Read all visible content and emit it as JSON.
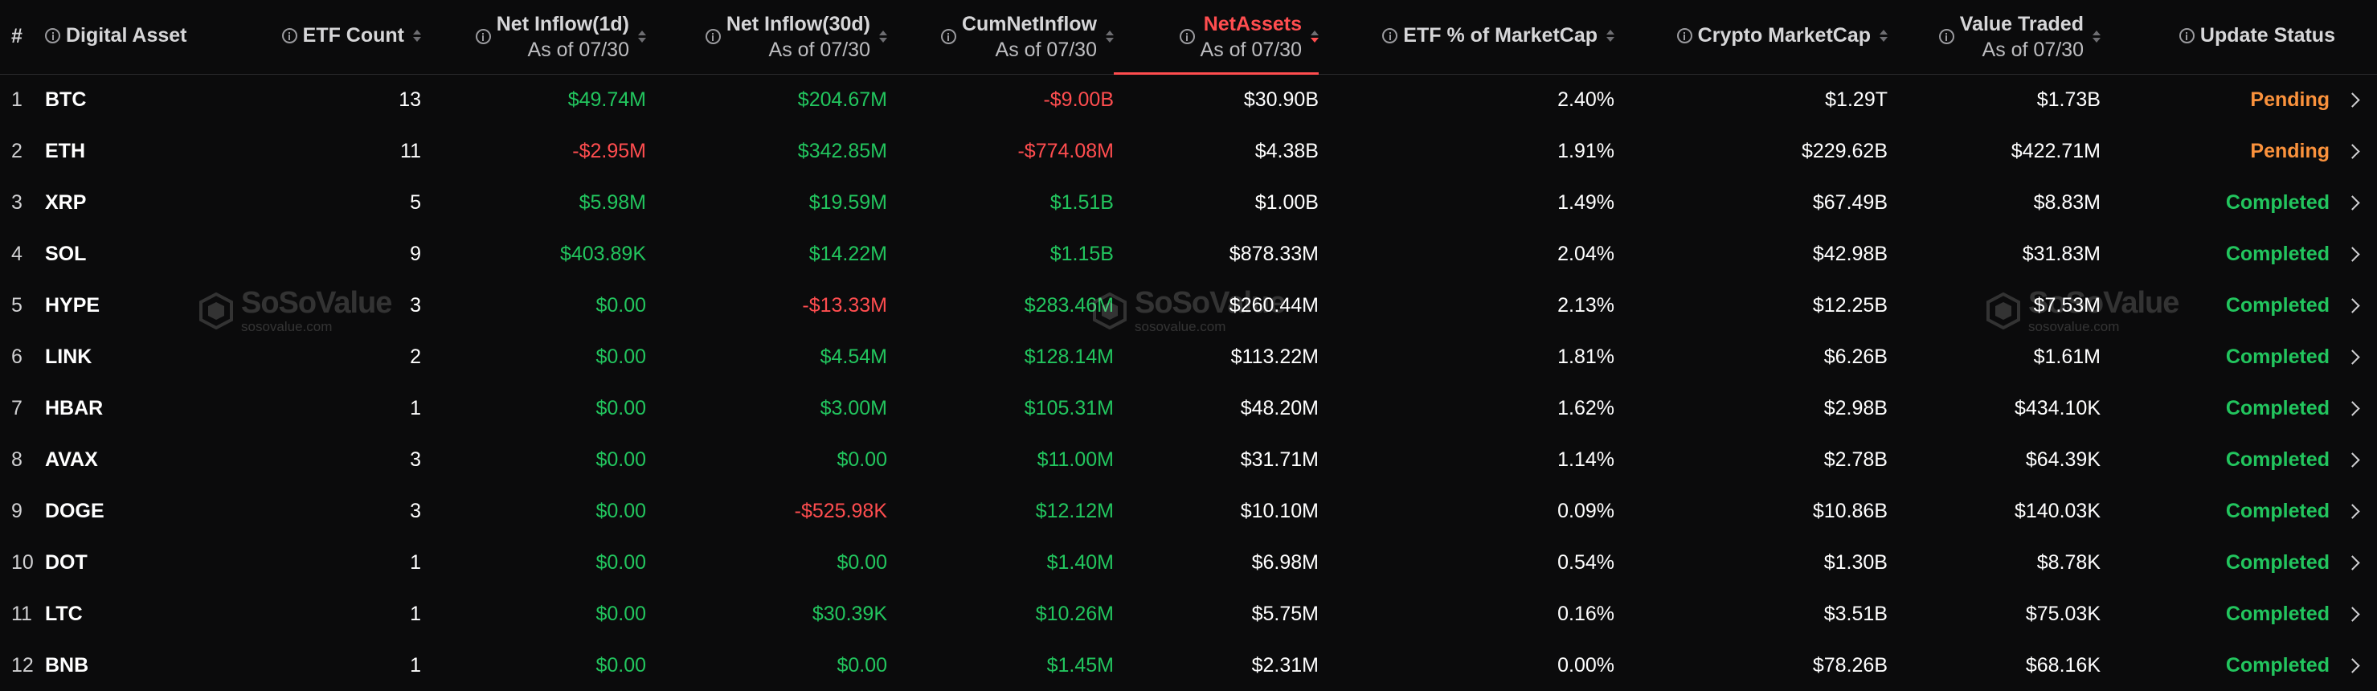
{
  "columns": {
    "rank": "#",
    "asset": "Digital Asset",
    "etf_count": "ETF Count",
    "inflow_1d": "Net Inflow(1d)",
    "inflow_1d_sub": "As of 07/30",
    "inflow_30d": "Net Inflow(30d)",
    "inflow_30d_sub": "As of 07/30",
    "cum_inflow": "CumNetInflow",
    "cum_inflow_sub": "As of 07/30",
    "net_assets": "NetAssets",
    "net_assets_sub": "As of 07/30",
    "etf_pct": "ETF % of MarketCap",
    "market_cap": "Crypto MarketCap",
    "value_traded": "Value Traded",
    "value_traded_sub": "As of 07/30",
    "update_status": "Update Status"
  },
  "rows": [
    {
      "rank": "1",
      "asset": "BTC",
      "etf_count": "13",
      "inflow_1d": "$49.74M",
      "inflow_30d": "$204.67M",
      "cum_inflow": "-$9.00B",
      "net_assets": "$30.90B",
      "etf_pct": "2.40%",
      "market_cap": "$1.29T",
      "value_traded": "$1.73B",
      "status": "Pending"
    },
    {
      "rank": "2",
      "asset": "ETH",
      "etf_count": "11",
      "inflow_1d": "-$2.95M",
      "inflow_30d": "$342.85M",
      "cum_inflow": "-$774.08M",
      "net_assets": "$4.38B",
      "etf_pct": "1.91%",
      "market_cap": "$229.62B",
      "value_traded": "$422.71M",
      "status": "Pending"
    },
    {
      "rank": "3",
      "asset": "XRP",
      "etf_count": "5",
      "inflow_1d": "$5.98M",
      "inflow_30d": "$19.59M",
      "cum_inflow": "$1.51B",
      "net_assets": "$1.00B",
      "etf_pct": "1.49%",
      "market_cap": "$67.49B",
      "value_traded": "$8.83M",
      "status": "Completed"
    },
    {
      "rank": "4",
      "asset": "SOL",
      "etf_count": "9",
      "inflow_1d": "$403.89K",
      "inflow_30d": "$14.22M",
      "cum_inflow": "$1.15B",
      "net_assets": "$878.33M",
      "etf_pct": "2.04%",
      "market_cap": "$42.98B",
      "value_traded": "$31.83M",
      "status": "Completed"
    },
    {
      "rank": "5",
      "asset": "HYPE",
      "etf_count": "3",
      "inflow_1d": "$0.00",
      "inflow_30d": "-$13.33M",
      "cum_inflow": "$283.46M",
      "net_assets": "$260.44M",
      "etf_pct": "2.13%",
      "market_cap": "$12.25B",
      "value_traded": "$7.53M",
      "status": "Completed"
    },
    {
      "rank": "6",
      "asset": "LINK",
      "etf_count": "2",
      "inflow_1d": "$0.00",
      "inflow_30d": "$4.54M",
      "cum_inflow": "$128.14M",
      "net_assets": "$113.22M",
      "etf_pct": "1.81%",
      "market_cap": "$6.26B",
      "value_traded": "$1.61M",
      "status": "Completed"
    },
    {
      "rank": "7",
      "asset": "HBAR",
      "etf_count": "1",
      "inflow_1d": "$0.00",
      "inflow_30d": "$3.00M",
      "cum_inflow": "$105.31M",
      "net_assets": "$48.20M",
      "etf_pct": "1.62%",
      "market_cap": "$2.98B",
      "value_traded": "$434.10K",
      "status": "Completed"
    },
    {
      "rank": "8",
      "asset": "AVAX",
      "etf_count": "3",
      "inflow_1d": "$0.00",
      "inflow_30d": "$0.00",
      "cum_inflow": "$11.00M",
      "net_assets": "$31.71M",
      "etf_pct": "1.14%",
      "market_cap": "$2.78B",
      "value_traded": "$64.39K",
      "status": "Completed"
    },
    {
      "rank": "9",
      "asset": "DOGE",
      "etf_count": "3",
      "inflow_1d": "$0.00",
      "inflow_30d": "-$525.98K",
      "cum_inflow": "$12.12M",
      "net_assets": "$10.10M",
      "etf_pct": "0.09%",
      "market_cap": "$10.86B",
      "value_traded": "$140.03K",
      "status": "Completed"
    },
    {
      "rank": "10",
      "asset": "DOT",
      "etf_count": "1",
      "inflow_1d": "$0.00",
      "inflow_30d": "$0.00",
      "cum_inflow": "$1.40M",
      "net_assets": "$6.98M",
      "etf_pct": "0.54%",
      "market_cap": "$1.30B",
      "value_traded": "$8.78K",
      "status": "Completed"
    },
    {
      "rank": "11",
      "asset": "LTC",
      "etf_count": "1",
      "inflow_1d": "$0.00",
      "inflow_30d": "$30.39K",
      "cum_inflow": "$10.26M",
      "net_assets": "$5.75M",
      "etf_pct": "0.16%",
      "market_cap": "$3.51B",
      "value_traded": "$75.03K",
      "status": "Completed"
    },
    {
      "rank": "12",
      "asset": "BNB",
      "etf_count": "1",
      "inflow_1d": "$0.00",
      "inflow_30d": "$0.00",
      "cum_inflow": "$1.45M",
      "net_assets": "$2.31M",
      "etf_pct": "0.00%",
      "market_cap": "$78.26B",
      "value_traded": "$68.16K",
      "status": "Completed"
    }
  ],
  "watermark": {
    "title": "SoSoValue",
    "subtitle": "sosovalue.com"
  },
  "colors": {
    "background": "#0b0b0c",
    "positive": "#22c55e",
    "negative": "#ff4d4f",
    "pending": "#fb923c",
    "active_sort": "#ff4d4f"
  },
  "sorted_column": "NetAssets",
  "icons": [
    "info-icon",
    "sort-icon",
    "chevron-right-icon",
    "sosovalue-logo-icon"
  ]
}
